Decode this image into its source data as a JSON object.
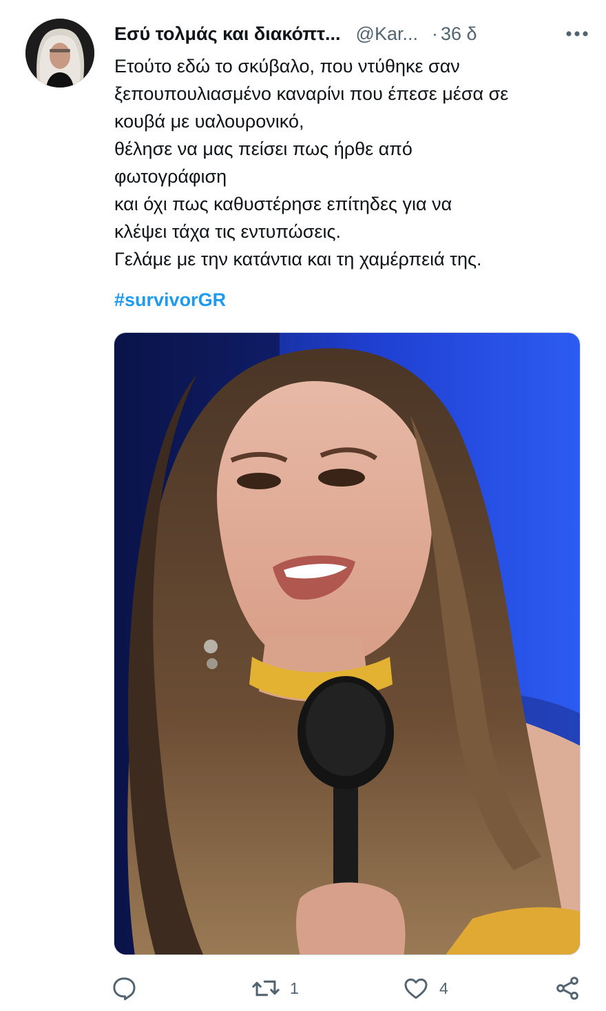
{
  "tweet": {
    "display_name": "Εσύ τολμάς και διακόπτ...",
    "handle": "@Kar...",
    "separator": "·",
    "time": "36 δ",
    "text_lines": [
      "Ετούτο εδώ το σκύβαλο, που ντύθηκε σαν",
      "ξεπουπουλιασμένο καναρίνι που έπεσε μέσα σε",
      "κουβά με υαλουρονικό,",
      "θέλησε να μας πείσει πως ήρθε από",
      "φωτογράφιση",
      "και όχι πως καθυστέρησε επίτηδες για να",
      "κλέψει τάχα τις εντυπώσεις.",
      "Γελάμε με την κατάντια και τη χαμέρπειά της."
    ],
    "hashtag": "#survivorGR"
  },
  "actions": {
    "reply_count": "",
    "retweet_count": "1",
    "like_count": "4"
  },
  "icons": {
    "more": "more-dots-icon",
    "reply": "reply-icon",
    "retweet": "retweet-icon",
    "like": "heart-icon",
    "share": "share-icon"
  },
  "colors": {
    "text": "#0f1419",
    "secondary": "#536471",
    "link": "#1d9bf0"
  }
}
